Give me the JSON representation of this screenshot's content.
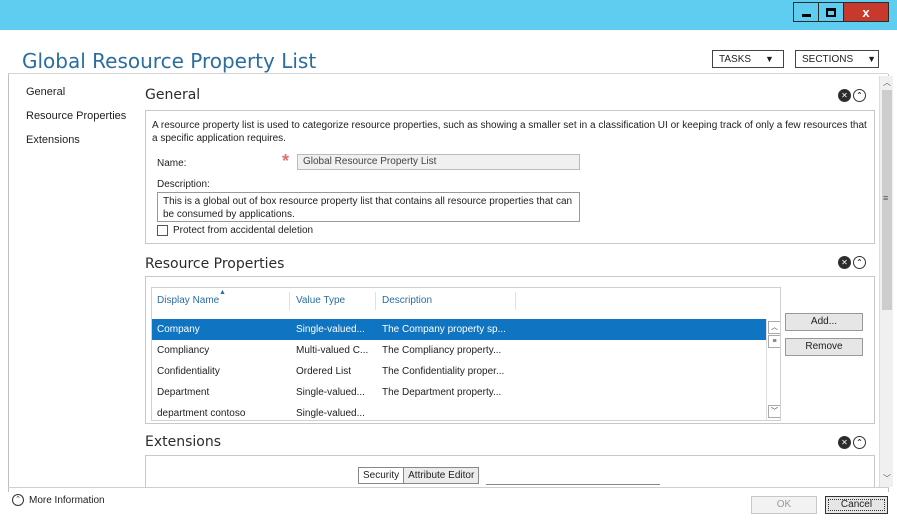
{
  "window": {
    "minimize_glyph": "",
    "close_glyph": "x"
  },
  "header": {
    "title": "Global Resource Property List",
    "tasks_label": "TASKS",
    "sections_label": "SECTIONS"
  },
  "nav": {
    "items": [
      "General",
      "Resource Properties",
      "Extensions"
    ]
  },
  "general": {
    "title": "General",
    "description": "A resource property list is used to categorize resource properties, such as showing a smaller set in a classification UI or keeping track of only a few resources that a specific application requires.",
    "name_label": "Name:",
    "name_value": "Global Resource Property List",
    "description_label": "Description:",
    "description_value": "This is a global out of box resource property list that contains all resource properties that can be consumed by applications.",
    "protect_label": "Protect from accidental deletion"
  },
  "resource_properties": {
    "title": "Resource Properties",
    "columns": [
      "Display Name",
      "Value Type",
      "Description"
    ],
    "rows": [
      [
        "Company",
        "Single-valued...",
        "The Company property sp..."
      ],
      [
        "Compliancy",
        "Multi-valued C...",
        "The Compliancy property..."
      ],
      [
        "Confidentiality",
        "Ordered List",
        "The Confidentiality proper..."
      ],
      [
        "Department",
        "Single-valued...",
        "The Department property..."
      ],
      [
        "department contoso",
        "Single-valued...",
        ""
      ]
    ],
    "add_label": "Add...",
    "remove_label": "Remove"
  },
  "extensions": {
    "title": "Extensions",
    "tabs": [
      "Security",
      "Attribute Editor"
    ]
  },
  "footer": {
    "more_info": "More Information",
    "ok_label": "OK",
    "cancel_label": "Cancel"
  },
  "colors": {
    "titlebar": "#5ecdf0",
    "selection": "#0f74c2",
    "title_text": "#2a6ea0"
  }
}
